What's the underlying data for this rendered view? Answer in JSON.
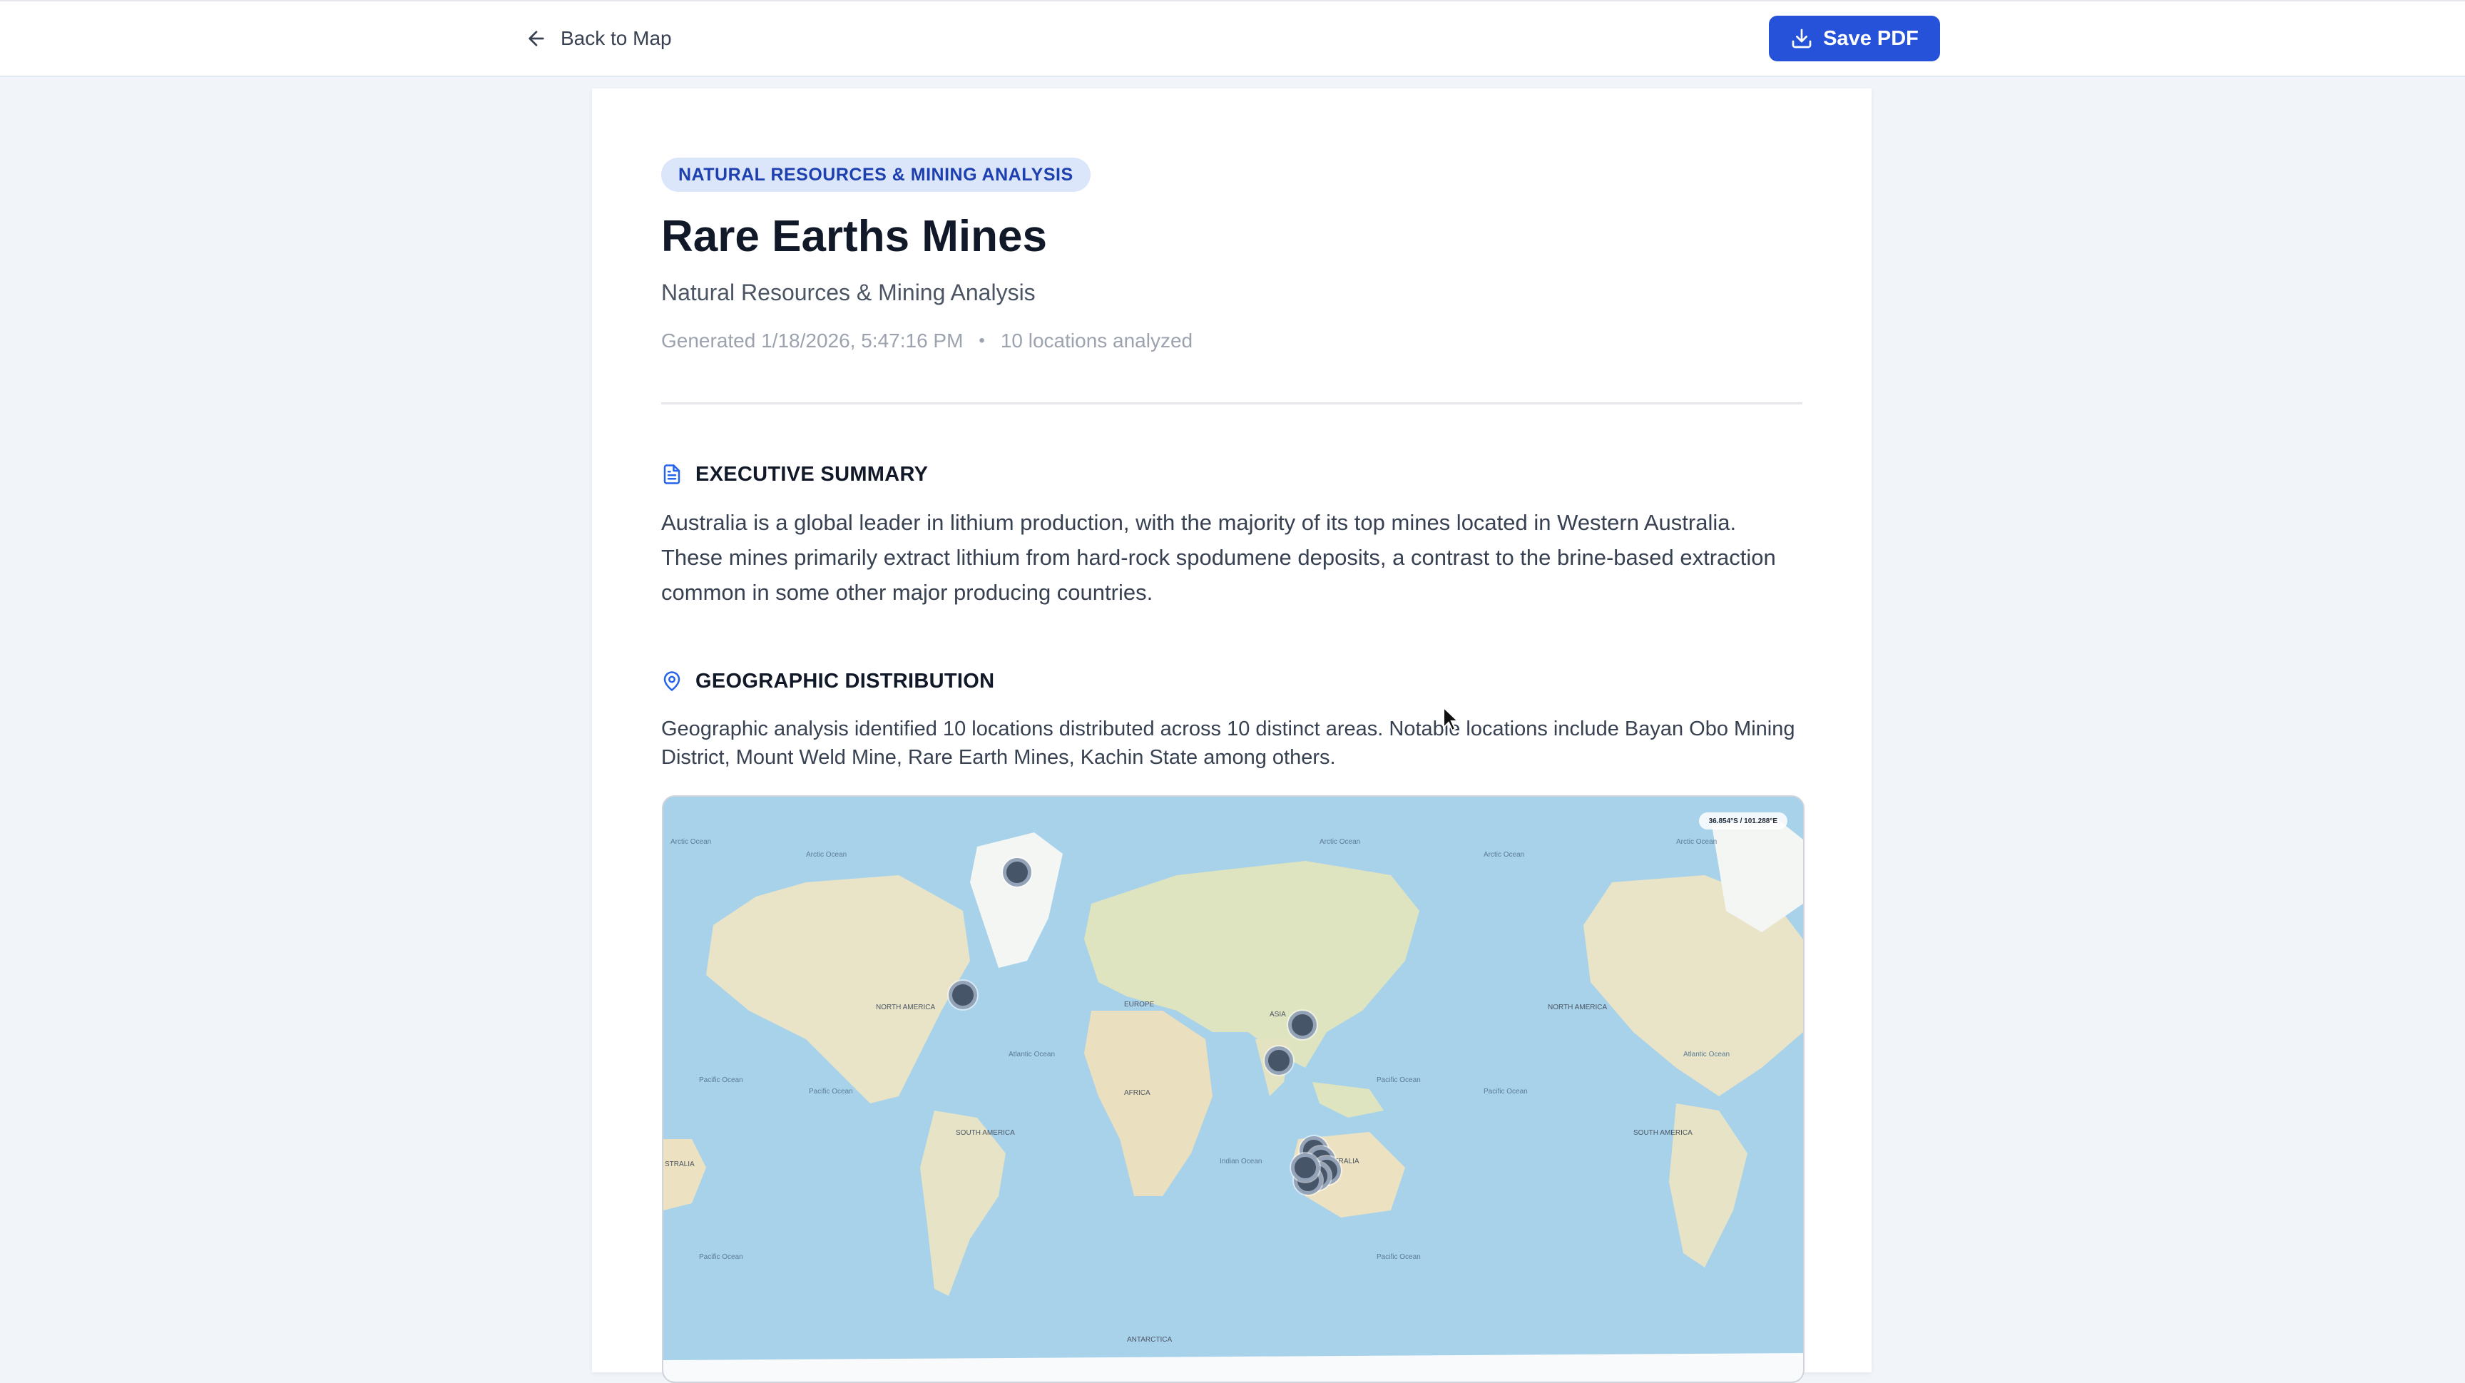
{
  "topbar": {
    "back_label": "Back to Map",
    "save_label": "Save PDF"
  },
  "report": {
    "badge": "NATURAL RESOURCES & MINING ANALYSIS",
    "title": "Rare Earths Mines",
    "subtitle": "Natural Resources & Mining Analysis",
    "generated": "Generated 1/18/2026, 5:47:16 PM",
    "separator": "•",
    "locations_count": "10 locations analyzed"
  },
  "executive_summary": {
    "heading": "EXECUTIVE SUMMARY",
    "icon": "document-icon",
    "text": "Australia is a global leader in lithium production, with the majority of its top mines located in Western Australia. These mines primarily extract lithium from hard-rock spodumene deposits, a contrast to the brine-based extraction common in some other major producing countries."
  },
  "geographic_distribution": {
    "heading": "GEOGRAPHIC DISTRIBUTION",
    "icon": "map-pin-icon",
    "text": "Geographic analysis identified 10 locations distributed across 10 distinct areas. Notable locations include Bayan Obo Mining District, Mount Weld Mine, Rare Earth Mines, Kachin State among others."
  },
  "map": {
    "coordinate_readout": "36.854°S / 101.288°E",
    "labels": [
      "Arctic Ocean",
      "Arctic Ocean",
      "Arctic Ocean",
      "Arctic Ocean",
      "Arctic Ocean",
      "NORTH AMERICA",
      "EUROPE",
      "ASIA",
      "NORTH AMERICA",
      "Atlantic Ocean",
      "Atlantic Ocean",
      "Pacific Ocean",
      "Pacific Ocean",
      "Pacific Ocean",
      "Pacific Ocean",
      "AFRICA",
      "SOUTH AMERICA",
      "SOUTH AMERICA",
      "Indian Ocean",
      "AUSTRALIA",
      "STRALIA",
      "Pacific Ocean",
      "Pacific Ocean",
      "ANTARCTICA"
    ],
    "colors": {
      "ocean": "#a8d2ea",
      "land": "#e9e4c8",
      "marker": "#475569"
    }
  }
}
